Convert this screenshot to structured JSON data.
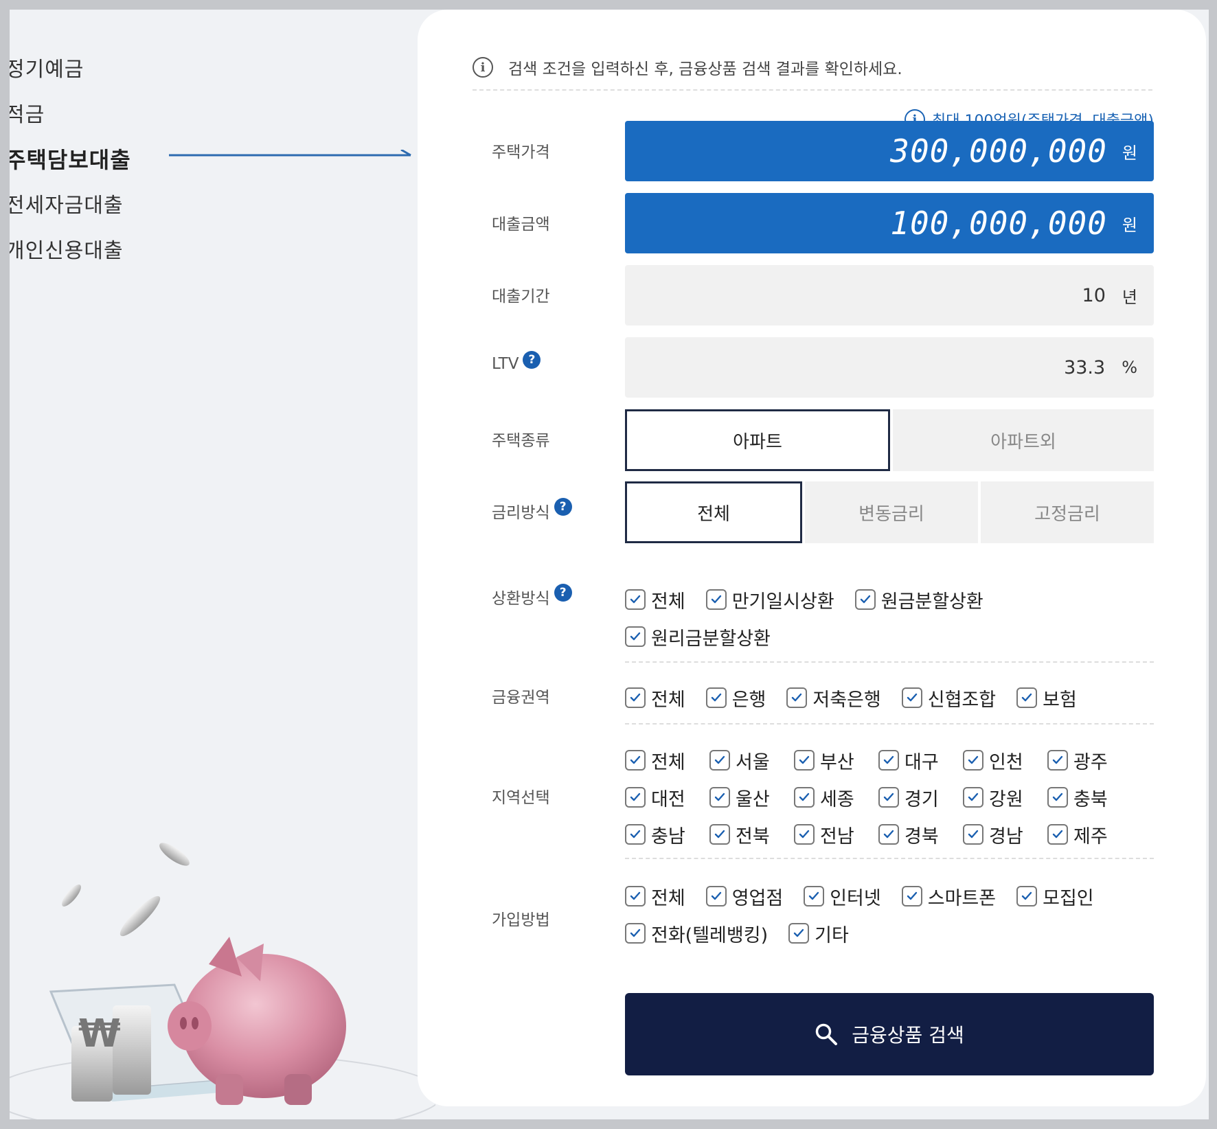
{
  "nav": {
    "items": [
      "정기예금",
      "적금",
      "주택담보대출",
      "전세자금대출",
      "개인신용대출"
    ],
    "active_index": 2
  },
  "notice": {
    "text": "검색 조건을 입력하신 후, 금융상품 검색 결과를 확인하세요."
  },
  "max_note": "최대 100억원(주택가격, 대출금액)",
  "fields": {
    "house_price": {
      "label": "주택가격",
      "value": "300,000,000",
      "unit": "원"
    },
    "loan_amount": {
      "label": "대출금액",
      "value": "100,000,000",
      "unit": "원"
    },
    "loan_term": {
      "label": "대출기간",
      "value": "10",
      "unit": "년"
    },
    "ltv": {
      "label": "LTV",
      "value": "33.3",
      "unit": "%"
    }
  },
  "house_type": {
    "label": "주택종류",
    "options": [
      "아파트",
      "아파트외"
    ],
    "selected": "아파트"
  },
  "rate_type": {
    "label": "금리방식",
    "options": [
      "전체",
      "변동금리",
      "고정금리"
    ],
    "selected": "전체"
  },
  "repayment": {
    "label": "상환방식",
    "rows": [
      [
        "전체",
        "만기일시상환",
        "원금분할상환"
      ],
      [
        "원리금분할상환"
      ]
    ]
  },
  "sector": {
    "label": "금융권역",
    "rows": [
      [
        "전체",
        "은행",
        "저축은행",
        "신협조합",
        "보험"
      ]
    ]
  },
  "region": {
    "label": "지역선택",
    "rows": [
      [
        "전체",
        "서울",
        "부산",
        "대구",
        "인천",
        "광주"
      ],
      [
        "대전",
        "울산",
        "세종",
        "경기",
        "강원",
        "충북"
      ],
      [
        "충남",
        "전북",
        "전남",
        "경북",
        "경남",
        "제주"
      ]
    ]
  },
  "join": {
    "label": "가입방법",
    "rows": [
      [
        "전체",
        "영업점",
        "인터넷",
        "스마트폰",
        "모집인"
      ],
      [
        "전화(텔레뱅킹)",
        "기타"
      ]
    ]
  },
  "search_button": "금융상품 검색",
  "colors": {
    "accent": "#1a6bc0",
    "button": "#121e44",
    "notice_blue": "#1a63b4"
  }
}
